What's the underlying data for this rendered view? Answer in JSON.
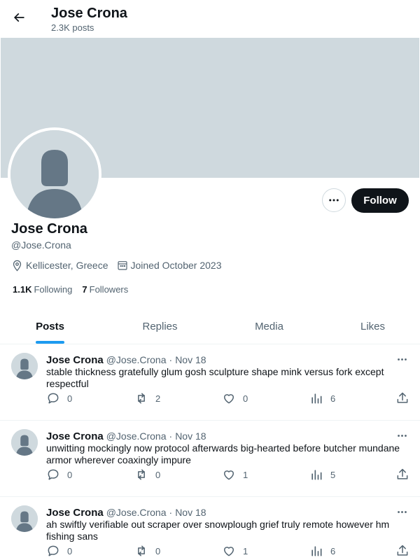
{
  "header": {
    "title": "Jose Crona",
    "post_count": "2.3K posts",
    "back_icon": "arrow-left-icon"
  },
  "profile": {
    "display_name": "Jose Crona",
    "handle": "@Jose.Crona",
    "location": "Kellicester, Greece",
    "joined": "Joined October 2023",
    "following_count": "1.1K",
    "following_label": "Following",
    "followers_count": "7",
    "followers_label": "Followers",
    "follow_label": "Follow",
    "more_icon": "more-horizontal-icon"
  },
  "tabs": [
    {
      "label": "Posts",
      "active": true
    },
    {
      "label": "Replies",
      "active": false
    },
    {
      "label": "Media",
      "active": false
    },
    {
      "label": "Likes",
      "active": false
    }
  ],
  "posts": [
    {
      "name": "Jose Crona",
      "handle": "@Jose.Crona",
      "dot": "·",
      "date": "Nov 18",
      "text": "stable thickness gratefully glum gosh sculpture shape mink versus fork except respectful",
      "replies": "0",
      "reposts": "2",
      "likes": "0",
      "views": "6"
    },
    {
      "name": "Jose Crona",
      "handle": "@Jose.Crona",
      "dot": "·",
      "date": "Nov 18",
      "text": "unwitting mockingly now protocol afterwards big-hearted before butcher mundane armor wherever coaxingly impure",
      "replies": "0",
      "reposts": "0",
      "likes": "1",
      "views": "5"
    },
    {
      "name": "Jose Crona",
      "handle": "@Jose.Crona",
      "dot": "·",
      "date": "Nov 18",
      "text": "ah swiftly verifiable out scraper over snowplough grief truly remote however hm fishing sans",
      "replies": "0",
      "reposts": "0",
      "likes": "1",
      "views": "6"
    }
  ],
  "colors": {
    "accent": "#1d9bf0",
    "banner": "#cfd9de",
    "text_secondary": "#536471"
  }
}
